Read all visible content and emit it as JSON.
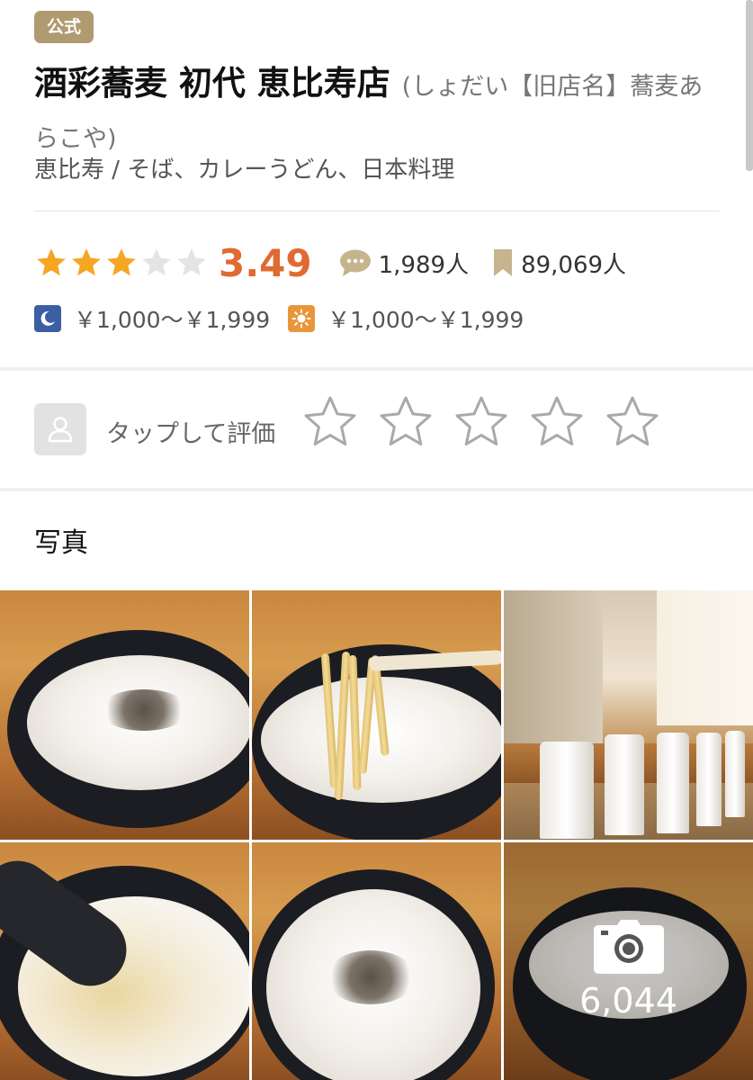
{
  "badge": {
    "label": "公式"
  },
  "restaurant": {
    "name": "酒彩蕎麦 初代 恵比寿店",
    "name_sub": "(しょだい【旧店名】蕎麦あらこや)",
    "area": "恵比寿",
    "separator": " / ",
    "genres": "そば、カレーうどん、日本料理"
  },
  "rating": {
    "score": "3.49",
    "stars": 3,
    "stars_max": 5,
    "reviews": "1,989人",
    "bookmarks": "89,069人"
  },
  "prices": {
    "dinner": "￥1,000～￥1,999",
    "lunch": "￥1,000～￥1,999"
  },
  "user_rating": {
    "label": "タップして評価",
    "stars_max": 5
  },
  "photos": {
    "section_title": "写真",
    "count": "6,044"
  },
  "icons": {
    "review": "speech-bubble-icon",
    "bookmark": "bookmark-icon",
    "dinner": "moon-icon",
    "lunch": "sun-icon",
    "avatar": "user-silhouette-icon",
    "camera": "camera-icon"
  },
  "colors": {
    "badge": "#b09a70",
    "score": "#e06a32",
    "star_filled": "#f5a623",
    "star_empty": "#e2e2e2",
    "dinner_icon": "#3c5fa3",
    "lunch_icon": "#e9963a"
  }
}
